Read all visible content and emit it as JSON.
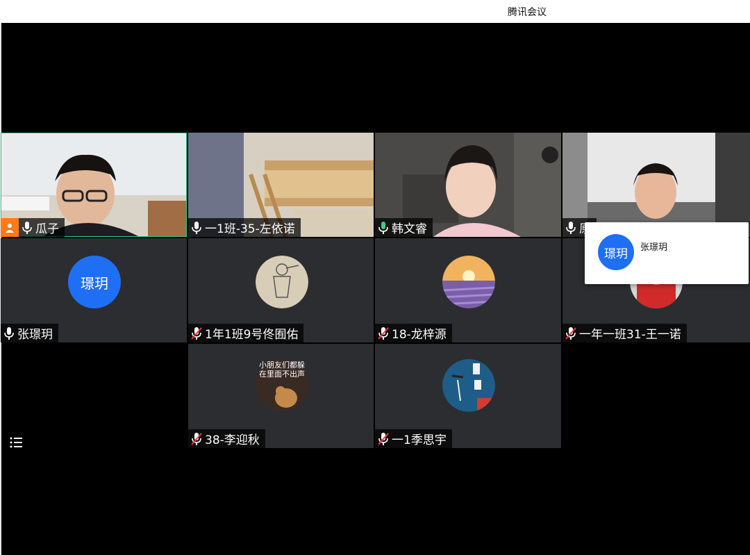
{
  "window": {
    "title": "腾讯会议"
  },
  "participants": [
    {
      "name": "瓜子",
      "mic": "on",
      "host": true,
      "type": "video"
    },
    {
      "name": "一1班-35-左依诺",
      "mic": "on",
      "type": "video"
    },
    {
      "name": "韩文睿",
      "mic": "speaking",
      "type": "video"
    },
    {
      "name": "原",
      "mic": "on",
      "type": "video"
    },
    {
      "name": "张璟玥",
      "mic": "on",
      "type": "text-avatar",
      "avatar_text": "璟玥"
    },
    {
      "name": "1年1班9号佟囿佑",
      "mic": "muted",
      "type": "photo-avatar"
    },
    {
      "name": "18-龙梓源",
      "mic": "muted",
      "type": "photo-avatar"
    },
    {
      "name": "一年一班31-王一诺",
      "mic": "muted",
      "type": "photo-avatar"
    },
    {
      "name": "38-李迎秋",
      "mic": "muted",
      "type": "photo-avatar"
    },
    {
      "name": "一1季思宇",
      "mic": "muted",
      "type": "photo-avatar"
    }
  ],
  "avatar_image_text": "小朋友们都躲在里面不出声",
  "popup": {
    "avatar_text": "璟玥",
    "name": "张璟玥"
  },
  "colors": {
    "accent": "#1f6ff5",
    "speaking": "#3fc98d",
    "host": "#ff7a1a",
    "tile": "#2b2d31"
  },
  "icons": [
    "mic-icon",
    "mic-muted-icon",
    "host-icon",
    "list-icon"
  ]
}
